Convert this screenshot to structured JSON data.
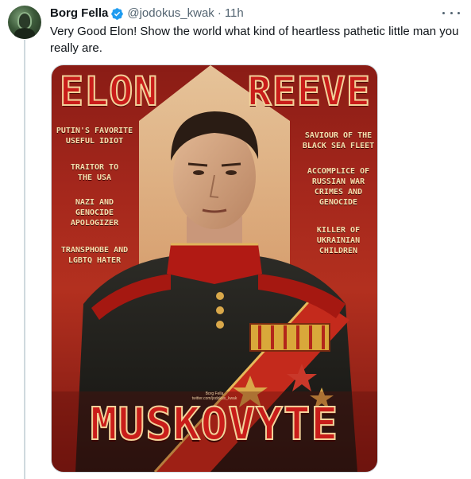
{
  "author": {
    "display_name": "Borg Fella",
    "handle": "@jodokus_kwak",
    "time_ago": "11h",
    "verified": true
  },
  "tweet": {
    "text": "Very Good Elon! Show the world what kind of heartless pathetic little man you really are."
  },
  "poster": {
    "title_left": "ELON",
    "title_right": "REEVE",
    "bottom_title": "MUSKOVYTE",
    "left_labels": [
      "PUTIN'S FAVORITE\nUSEFUL IDIOT",
      "TRAITOR TO\nTHE USA",
      "NAZI AND\nGENOCIDE\nAPOLOGIZER",
      "TRANSPHOBE AND\nLGBTQ HATER"
    ],
    "right_labels": [
      "SAVIOUR OF THE\nBLACK SEA FLEET",
      "ACCOMPLICE OF\nRUSSIAN WAR\nCRIMES AND\nGENOCIDE",
      "KILLER OF\nUKRAINIAN\nCHILDREN"
    ],
    "credit_line1": "Borg Fella",
    "credit_line2": "twitter.com/jodokus_kwak"
  },
  "colors": {
    "poster_red": "#a4271c",
    "title_red": "#c91d1a",
    "label_cream": "#f6dfae",
    "verified_blue": "#1d9bf0"
  },
  "icons": {
    "verified": "verified-badge-icon",
    "more": "more-dots-icon"
  }
}
